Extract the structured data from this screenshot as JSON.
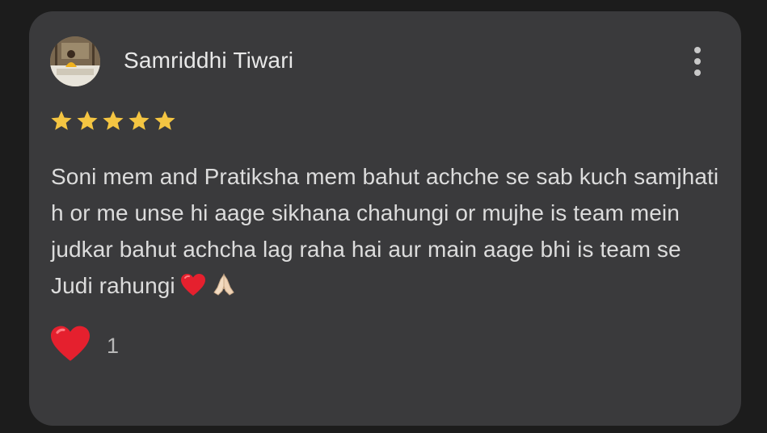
{
  "review": {
    "author": "Samriddhi Tiwari",
    "rating": 5,
    "max_rating": 5,
    "text": "Soni mem and Pratiksha mem bahut achche se sab kuch samjhati h or me unse hi aage sikhana chahungi or mujhe is team mein judkar bahut achcha lag raha hai aur main aage bhi is team se Judi rahungi",
    "text_emojis": [
      "red-heart",
      "folded-hands"
    ],
    "reaction": {
      "icon": "red-heart",
      "count": "1"
    }
  },
  "colors": {
    "background": "#1c1c1c",
    "card": "#3a3a3c",
    "star": "#f4c542",
    "heart": "#e5202e",
    "text": "#dcdcdc"
  }
}
